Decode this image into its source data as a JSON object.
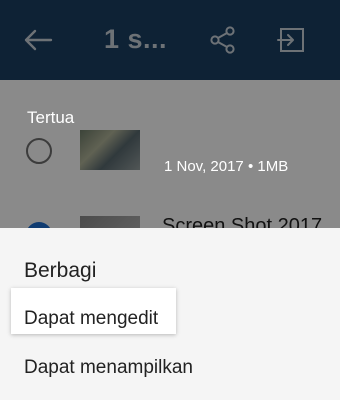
{
  "header": {
    "title": "1 s..."
  },
  "icons": {
    "back": "back-arrow-icon",
    "share": "share-icon",
    "move": "move-to-icon"
  },
  "list": {
    "section_label": "Tertua",
    "rows": [
      {
        "meta": "1 Nov,  2017 • 1MB"
      },
      {
        "name": "Screen Shot 2017"
      }
    ]
  },
  "sheet": {
    "title": "Berbagi",
    "options": [
      {
        "label": "Dapat mengedit"
      },
      {
        "label": "Dapat menampilkan"
      }
    ]
  },
  "colors": {
    "appbar": "#1b3f63",
    "sheet_background": "#f5f5f5",
    "selected_accent": "#1f6fd1"
  }
}
